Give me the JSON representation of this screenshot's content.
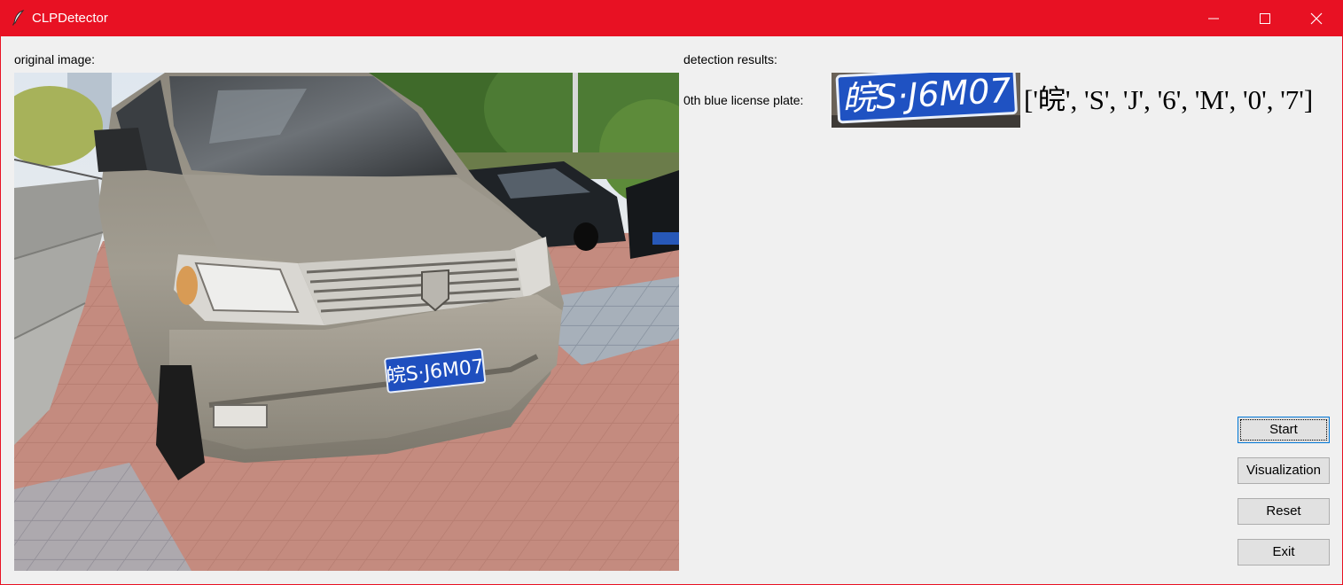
{
  "window": {
    "title": "CLPDetector",
    "icon": "feather-icon",
    "accent_color": "#e81123",
    "controls": {
      "minimize": "minimize-icon",
      "maximize": "maximize-icon",
      "close": "close-icon"
    }
  },
  "left_panel": {
    "label": "original image:"
  },
  "right_panel": {
    "label": "detection results:",
    "plates": [
      {
        "label": "0th blue license plate:",
        "plate_text": "皖S·J6M07",
        "result": "['皖', 'S', 'J', '6', 'M', '0', '7']"
      }
    ]
  },
  "buttons": {
    "start": "Start",
    "visualization": "Visualization",
    "reset": "Reset",
    "exit": "Exit"
  }
}
